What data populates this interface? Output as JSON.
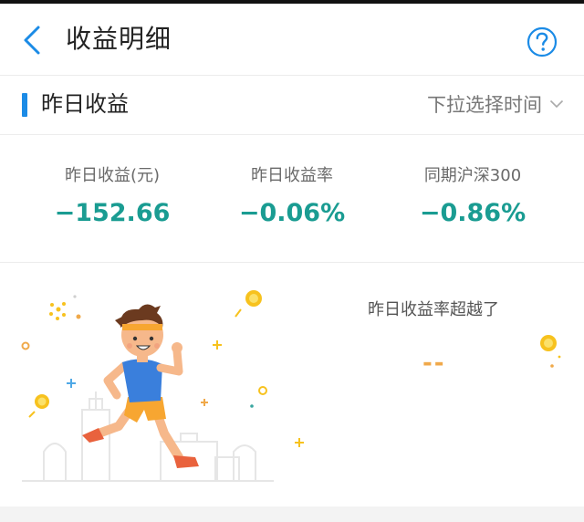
{
  "header": {
    "title": "收益明细",
    "back_icon": "chevron-left-icon",
    "help_icon": "question-circle-icon",
    "accent_color": "#1b8be6"
  },
  "section": {
    "title": "昨日收益",
    "time_select_label": "下拉选择时间",
    "time_select_icon": "chevron-down-icon"
  },
  "stats": [
    {
      "label": "昨日收益(元)",
      "value": "−152.66"
    },
    {
      "label": "昨日收益率",
      "value": "−0.06%"
    },
    {
      "label": "同期沪深300",
      "value": "−0.86%"
    }
  ],
  "stat_value_color": "#1a9c92",
  "beat": {
    "label": "昨日收益率超越了",
    "value": "--",
    "value_color": "#f0a94a"
  }
}
